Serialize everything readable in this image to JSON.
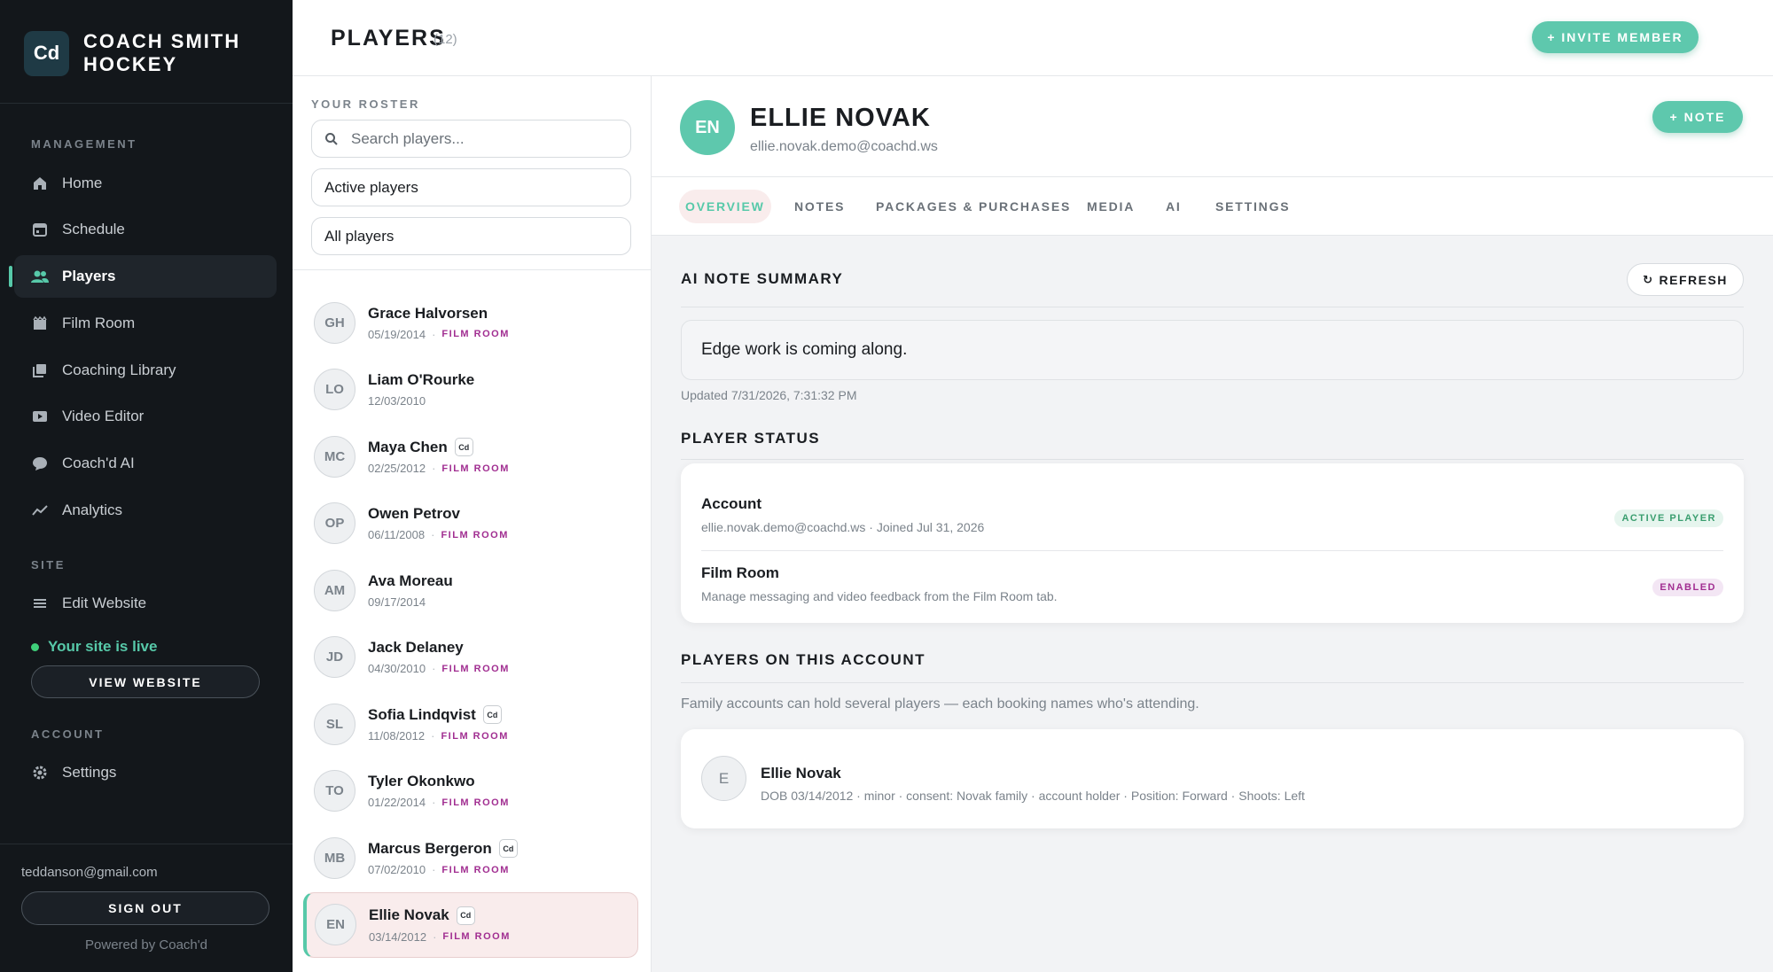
{
  "brand": {
    "logo": "Cd",
    "name": "COACH SMITH HOCKEY"
  },
  "sidebar": {
    "management_label": "MANAGEMENT",
    "items": [
      {
        "label": "Home",
        "icon": "home-icon"
      },
      {
        "label": "Schedule",
        "icon": "calendar-icon"
      },
      {
        "label": "Players",
        "icon": "players-icon",
        "active": true
      },
      {
        "label": "Film Room",
        "icon": "film-icon"
      },
      {
        "label": "Coaching Library",
        "icon": "library-icon"
      },
      {
        "label": "Video Editor",
        "icon": "video-icon"
      },
      {
        "label": "Coach'd AI",
        "icon": "chat-icon"
      },
      {
        "label": "Analytics",
        "icon": "analytics-icon"
      }
    ],
    "site_label": "SITE",
    "edit_website": "Edit Website",
    "site_status": "Your site is live",
    "view_website": "VIEW WEBSITE",
    "account_label": "ACCOUNT",
    "settings": "Settings",
    "user_email": "teddanson@gmail.com",
    "sign_out": "SIGN OUT",
    "powered_by": "Powered by Coach'd"
  },
  "header": {
    "title": "PLAYERS",
    "count": "(12)",
    "invite_button": "+ INVITE MEMBER"
  },
  "roster": {
    "label": "YOUR ROSTER",
    "search_placeholder": "Search players...",
    "filter_status": "Active players",
    "filter_group": "All players",
    "players": [
      {
        "initials": "GH",
        "name": "Grace Halvorsen",
        "dob": "05/19/2014",
        "tag": "FILM ROOM",
        "badge": ""
      },
      {
        "initials": "LO",
        "name": "Liam O'Rourke",
        "dob": "12/03/2010",
        "tag": "",
        "badge": ""
      },
      {
        "initials": "MC",
        "name": "Maya Chen",
        "dob": "02/25/2012",
        "tag": "FILM ROOM",
        "badge": "Cd"
      },
      {
        "initials": "OP",
        "name": "Owen Petrov",
        "dob": "06/11/2008",
        "tag": "FILM ROOM",
        "badge": ""
      },
      {
        "initials": "AM",
        "name": "Ava Moreau",
        "dob": "09/17/2014",
        "tag": "",
        "badge": ""
      },
      {
        "initials": "JD",
        "name": "Jack Delaney",
        "dob": "04/30/2010",
        "tag": "FILM ROOM",
        "badge": ""
      },
      {
        "initials": "SL",
        "name": "Sofia Lindqvist",
        "dob": "11/08/2012",
        "tag": "FILM ROOM",
        "badge": "Cd"
      },
      {
        "initials": "TO",
        "name": "Tyler Okonkwo",
        "dob": "01/22/2014",
        "tag": "FILM ROOM",
        "badge": ""
      },
      {
        "initials": "MB",
        "name": "Marcus Bergeron",
        "dob": "07/02/2010",
        "tag": "FILM ROOM",
        "badge": "Cd"
      },
      {
        "initials": "EN",
        "name": "Ellie Novak",
        "dob": "03/14/2012",
        "tag": "FILM ROOM",
        "badge": "Cd",
        "selected": true
      }
    ]
  },
  "detail": {
    "initials": "EN",
    "name": "ELLIE NOVAK",
    "email": "ellie.novak.demo@coachd.ws",
    "note_button": "+ NOTE",
    "tabs": [
      "OVERVIEW",
      "NOTES",
      "PACKAGES & PURCHASES",
      "MEDIA",
      "AI",
      "SETTINGS"
    ],
    "active_tab": "OVERVIEW",
    "ai_summary": {
      "title": "AI NOTE SUMMARY",
      "refresh": "REFRESH",
      "text": "Edge work is coming along.",
      "updated": "Updated 7/31/2026, 7:31:32 PM"
    },
    "status": {
      "title": "PLAYER STATUS",
      "account_title": "Account",
      "account_sub": "ellie.novak.demo@coachd.ws · Joined Jul 31, 2026",
      "account_pill": "ACTIVE PLAYER",
      "film_title": "Film Room",
      "film_sub": "Manage messaging and video feedback from the Film Room tab.",
      "film_pill": "ENABLED"
    },
    "family": {
      "title": "PLAYERS ON THIS ACCOUNT",
      "note": "Family accounts can hold several players — each booking names who's attending.",
      "initial": "E",
      "name": "Ellie Novak",
      "meta": "DOB 03/14/2012 · minor · consent: Novak family · account holder · Position: Forward · Shoots: Left"
    }
  },
  "colors": {
    "accent": "#5ec8ad",
    "tag": "#a12e91",
    "sidebar_bg": "#13171b"
  }
}
